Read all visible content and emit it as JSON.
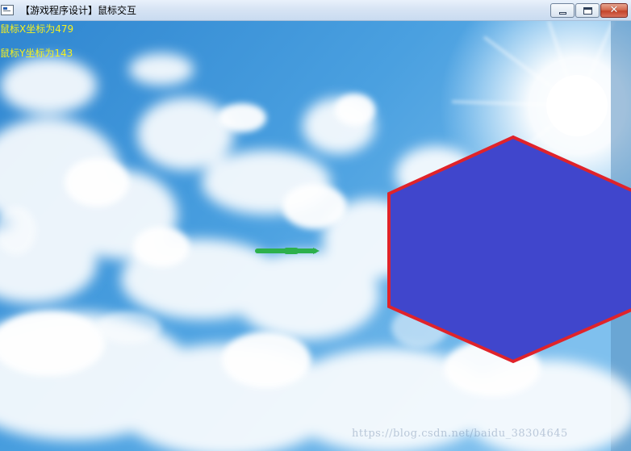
{
  "window": {
    "title": "【游戏程序设计】鼠标交互",
    "minimize_icon": "minimize-icon",
    "maximize_icon": "maximize-icon",
    "close_icon": "close-icon",
    "close_glyph": "✕"
  },
  "overlay": {
    "mouse_x_label": "鼠标X坐标为479",
    "mouse_y_label": "鼠标Y坐标为143",
    "label_color": "#f5f01e"
  },
  "scene": {
    "background": "sky-with-clouds",
    "sky_color": "#3f92d6",
    "hexagon_fill": "#4046cc",
    "hexagon_stroke": "#e0232a",
    "arrow_color": "#2db04c"
  },
  "watermark": {
    "text": "https://blog.csdn.net/baidu_38304645"
  }
}
